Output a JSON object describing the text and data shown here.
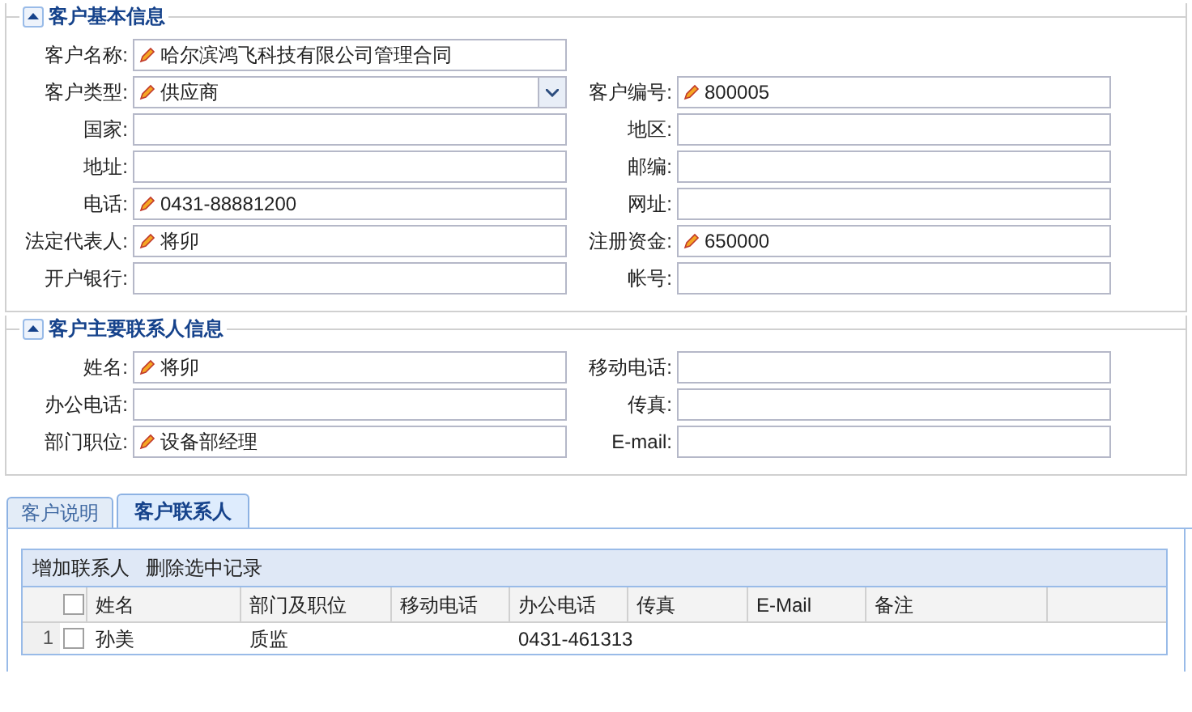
{
  "sections": [
    {
      "title": "客户基本信息",
      "expanded": true,
      "rows": [
        [
          {
            "label": "客户名称:",
            "value": "哈尔滨鸿飞科技有限公司管理合同",
            "modified": true,
            "kind": "text"
          }
        ],
        [
          {
            "label": "客户类型:",
            "value": "供应商",
            "modified": true,
            "kind": "combo"
          },
          {
            "label": "客户编号:",
            "value": "800005",
            "modified": true,
            "kind": "text"
          }
        ],
        [
          {
            "label": "国家:",
            "modified": false,
            "kind": "text"
          },
          {
            "label": "地区:",
            "modified": false,
            "kind": "text"
          }
        ],
        [
          {
            "label": "地址:",
            "modified": false,
            "kind": "text"
          },
          {
            "label": "邮编:",
            "modified": false,
            "kind": "text"
          }
        ],
        [
          {
            "label": "电话:",
            "value": "0431-88881200",
            "modified": true,
            "kind": "text"
          },
          {
            "label": "网址:",
            "modified": false,
            "kind": "text"
          }
        ],
        [
          {
            "label": "法定代表人:",
            "value": "将卯",
            "modified": true,
            "kind": "text"
          },
          {
            "label": "注册资金:",
            "value": "650000",
            "modified": true,
            "kind": "text"
          }
        ],
        [
          {
            "label": "开户银行:",
            "modified": false,
            "kind": "text"
          },
          {
            "label": "帐号:",
            "modified": false,
            "kind": "text"
          }
        ]
      ]
    },
    {
      "title": "客户主要联系人信息",
      "expanded": true,
      "rows": [
        [
          {
            "label": "姓名:",
            "value": "将卯",
            "modified": true,
            "kind": "text"
          },
          {
            "label": "移动电话:",
            "modified": false,
            "kind": "text"
          }
        ],
        [
          {
            "label": "办公电话:",
            "modified": false,
            "kind": "text"
          },
          {
            "label": "传真:",
            "modified": false,
            "kind": "text"
          }
        ],
        [
          {
            "label": "部门职位:",
            "value": "设备部经理",
            "modified": true,
            "kind": "text"
          },
          {
            "label": "E-mail:",
            "modified": false,
            "kind": "text"
          }
        ]
      ]
    }
  ],
  "tabs": [
    {
      "label": "客户说明",
      "selected": false
    },
    {
      "label": "客户联系人",
      "selected": true
    }
  ],
  "toolbar": [
    "增加联系人",
    "删除选中记录"
  ],
  "table": {
    "header_checked": false,
    "columns": [
      "姓名",
      "部门及职位",
      "移动电话",
      "办公电话",
      "传真",
      "E-Mail",
      "备注"
    ],
    "rows": [
      {
        "number": "1",
        "checked": false,
        "cells": [
          "孙美",
          "质监",
          "",
          "0431-461313",
          "",
          "",
          ""
        ]
      }
    ]
  }
}
